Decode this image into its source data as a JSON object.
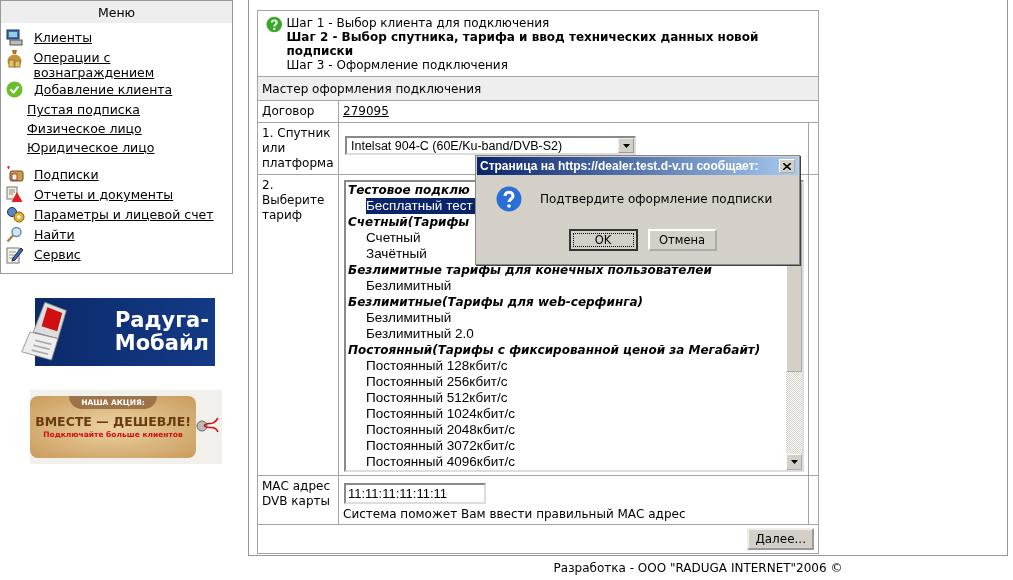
{
  "menu": {
    "title": "Меню",
    "items": [
      {
        "kind": "main",
        "label": "Клиенты"
      },
      {
        "kind": "main",
        "label": "Операции с вознаграждением"
      },
      {
        "kind": "main",
        "label": "Добавление клиента"
      },
      {
        "kind": "sub",
        "label": "Пустая подписка"
      },
      {
        "kind": "sub",
        "label": "Физическое лицо"
      },
      {
        "kind": "sub",
        "label": "Юридическое лицо"
      },
      {
        "kind": "main",
        "label": "Подписки"
      },
      {
        "kind": "main",
        "label": "Отчеты и документы"
      },
      {
        "kind": "main",
        "label": "Параметры и лицевой счет"
      },
      {
        "kind": "main",
        "label": "Найти"
      },
      {
        "kind": "main",
        "label": "Сервис"
      }
    ]
  },
  "banners": [
    {
      "kind": "mobile",
      "lines": [
        "Радуга-",
        "Мобайл"
      ]
    },
    {
      "kind": "promo",
      "lines": [
        "НАША АКЦИЯ:",
        "ВМЕСТЕ — ДЕШЕВЛЕ!",
        "Подключайте больше клиентов"
      ]
    }
  ],
  "steps": [
    {
      "text": "Шаг 1 - Выбор клиента для подключения",
      "current": false
    },
    {
      "text": "Шаг 2 - Выбор спутника, тарифа и ввод технических данных новой подписки",
      "current": true
    },
    {
      "text": "Шаг 3 - Оформление подключения",
      "current": false
    }
  ],
  "wizard": {
    "title": "Мастер оформления подключения",
    "contract": {
      "label": "Договор",
      "value": "279095"
    },
    "satellite": {
      "label": "1. Спутник или платформа",
      "value": "Intelsat 904-C (60E/Ku-band/DVB-S2)"
    },
    "tariff": {
      "label": "2. Выберите тариф",
      "options": [
        {
          "kind": "group",
          "text": "Тестовое подклю"
        },
        {
          "kind": "option",
          "text": "Бесплатный тест",
          "selected": true
        },
        {
          "kind": "group",
          "text": "Счетный(Тарифы"
        },
        {
          "kind": "option",
          "text": "Счетный",
          "selected": false
        },
        {
          "kind": "option",
          "text": "Зачётный",
          "selected": false
        },
        {
          "kind": "group",
          "text": "Безлимитные тарифы для конечных пользователей"
        },
        {
          "kind": "option",
          "text": "Безлимитный",
          "selected": false
        },
        {
          "kind": "group",
          "text": "Безлимитные(Тарифы для web-серфинга)"
        },
        {
          "kind": "option",
          "text": "Безлимитный",
          "selected": false
        },
        {
          "kind": "option",
          "text": "Безлимитный 2.0",
          "selected": false
        },
        {
          "kind": "group",
          "text": "Постоянный(Тарифы с фиксированной ценой за Мегабайт)"
        },
        {
          "kind": "option",
          "text": "Постоянный 128кбит/с",
          "selected": false
        },
        {
          "kind": "option",
          "text": "Постоянный 256кбит/с",
          "selected": false
        },
        {
          "kind": "option",
          "text": "Постоянный 512кбит/с",
          "selected": false
        },
        {
          "kind": "option",
          "text": "Постоянный 1024кбит/с",
          "selected": false
        },
        {
          "kind": "option",
          "text": "Постоянный 2048кбит/с",
          "selected": false
        },
        {
          "kind": "option",
          "text": "Постоянный 3072кбит/с",
          "selected": false
        },
        {
          "kind": "option",
          "text": "Постоянный 4096кбит/с",
          "selected": false
        }
      ]
    },
    "mac": {
      "label": "МАС адрес DVB карты",
      "value": "11:11:11:11:11:11",
      "hint": "Система поможет Вам ввести правильный МАС адрес"
    },
    "next_button": "Далее..."
  },
  "dialog": {
    "title": "Страница на https://dealer.test.d-v.ru сообщает:",
    "message": "Подтвердите оформление подписки",
    "buttons": [
      {
        "label": "OK",
        "focused": true
      },
      {
        "label": "Отмена",
        "focused": false
      }
    ]
  },
  "footer": "Разработка - ООО \"RADUGA INTERNET\"2006 ©"
}
